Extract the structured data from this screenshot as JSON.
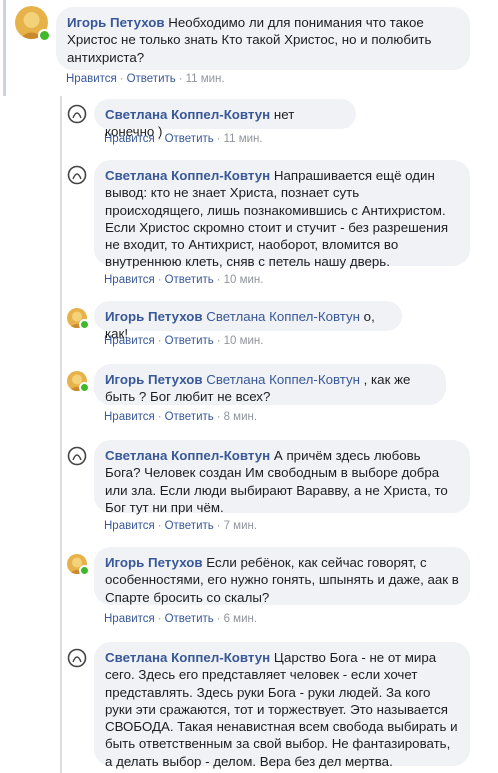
{
  "colors": {
    "link": "#385898",
    "bubble": "#f0f2f5",
    "online": "#42b72a",
    "meta": "#90949c"
  },
  "comments": [
    {
      "author": "Игорь Петухов",
      "mention": "",
      "text": "Необходимо ли для понимания что такое Христос не только знать Кто такой Христос, но и полюбить антихриста?",
      "like": "Нравится",
      "reply": "Ответить",
      "time": "11 мин."
    },
    {
      "author": "Светлана Коппел-Ковтун",
      "mention": "",
      "text": "нет конечно )",
      "like": "Нравится",
      "reply": "Ответить",
      "time": "11 мин."
    },
    {
      "author": "Светлана Коппел-Ковтун",
      "mention": "",
      "text": "Напрашивается ещё один вывод: кто не знает Христа, познает суть происходящего, лишь познакомившись с Антихристом. Если Христос скромно стоит и стучит - без разрешения не входит, то Антихрист, наоборот, вломится во внутреннюю клеть, сняв с петель нашу дверь.",
      "like": "Нравится",
      "reply": "Ответить",
      "time": "10 мин."
    },
    {
      "author": "Игорь Петухов",
      "mention": "Светлана Коппел-Ковтун",
      "text": "о, как!",
      "like": "Нравится",
      "reply": "Ответить",
      "time": "10 мин."
    },
    {
      "author": "Игорь Петухов",
      "mention": "Светлана Коппел-Ковтун",
      "text": ", как же быть ? Бог любит не всех?",
      "like": "Нравится",
      "reply": "Ответить",
      "time": "8 мин."
    },
    {
      "author": "Светлана Коппел-Ковтун",
      "mention": "",
      "text": "А причём здесь любовь Бога? Человек создан Им свободным в выборе добра или зла. Если люди выбирают Варавву, а не Христа, то Бог тут ни при чём.",
      "like": "Нравится",
      "reply": "Ответить",
      "time": "7 мин."
    },
    {
      "author": "Игорь Петухов",
      "mention": "",
      "text": "Если ребёнок, как сейчас говорят, с особенностями, его нужно гонять, шпынять и даже, аак в Спарте бросить со скалы?",
      "like": "Нравится",
      "reply": "Ответить",
      "time": "6 мин."
    },
    {
      "author": "Светлана Коппел-Ковтун",
      "mention": "",
      "text": "Царство Бога - не от мира сего. Здесь его представляет человек - если хочет представлять. Здесь руки Бога - руки людей. За кого руки эти сражаются, тот и торжествует. Это называется СВОБОДА. Такая ненавистная всем свобода выбирать и быть ответственным за свой выбор. Не фантазировать, а делать выбор - делом. Вера без дел мертва.",
      "like": "",
      "reply": "",
      "time": ""
    }
  ]
}
